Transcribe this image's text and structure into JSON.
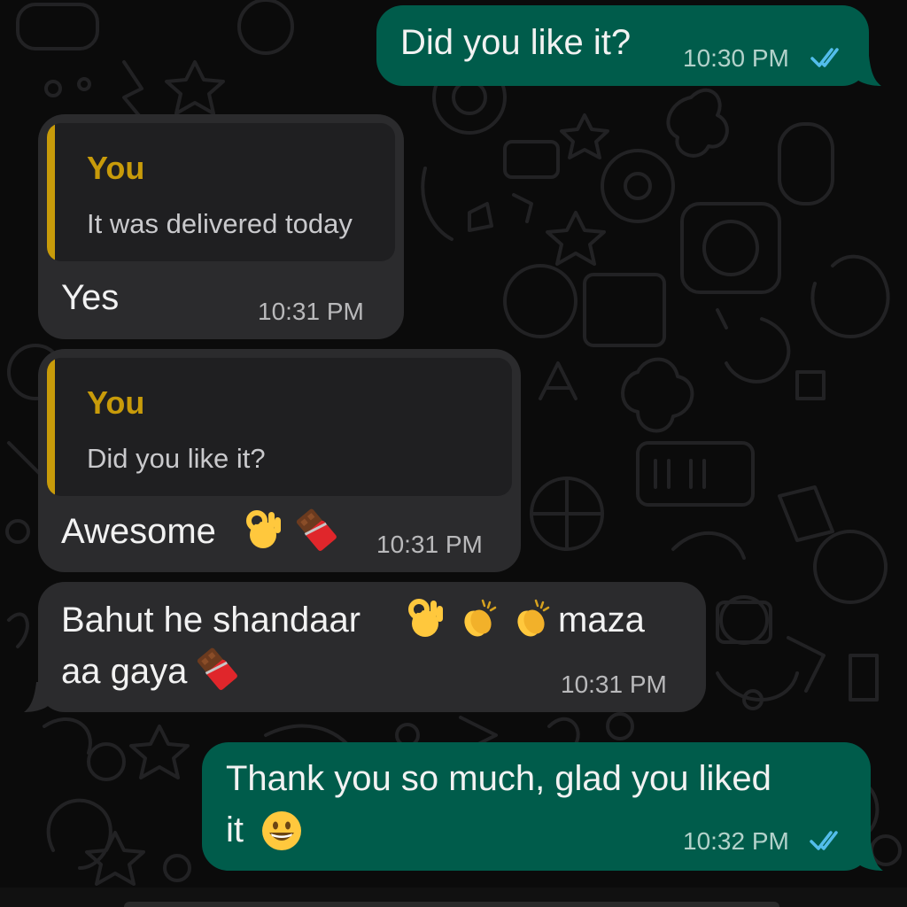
{
  "chat": {
    "messages": [
      {
        "direction": "outgoing",
        "text": "Did you like it?",
        "time": "10:30 PM",
        "status": "read"
      },
      {
        "direction": "incoming",
        "quote": {
          "author": "You",
          "text": "It was delivered today"
        },
        "text": "Yes",
        "time": "10:31 PM"
      },
      {
        "direction": "incoming",
        "quote": {
          "author": "You",
          "text": "Did you like it?"
        },
        "text": "Awesome",
        "emojis": [
          "ok-hand",
          "chocolate-bar"
        ],
        "time": "10:31 PM"
      },
      {
        "direction": "incoming",
        "line1": "Bahut he shandaar",
        "line1_end": "maza",
        "line2": "aa gaya",
        "emojis": [
          "ok-hand",
          "clapping-hands",
          "clapping-hands",
          "chocolate-bar"
        ],
        "time": "10:31 PM"
      },
      {
        "direction": "outgoing",
        "line1": "Thank you so much, glad you liked",
        "line2": "it",
        "emojis": [
          "grinning-face"
        ],
        "time": "10:32 PM",
        "status": "read"
      }
    ]
  },
  "colors": {
    "outgoing_bubble": "#005c4b",
    "incoming_bubble": "#2b2b2d",
    "quote_accent": "#c89b0a",
    "read_ticks": "#53bdeb",
    "background": "#0b0b0b"
  }
}
